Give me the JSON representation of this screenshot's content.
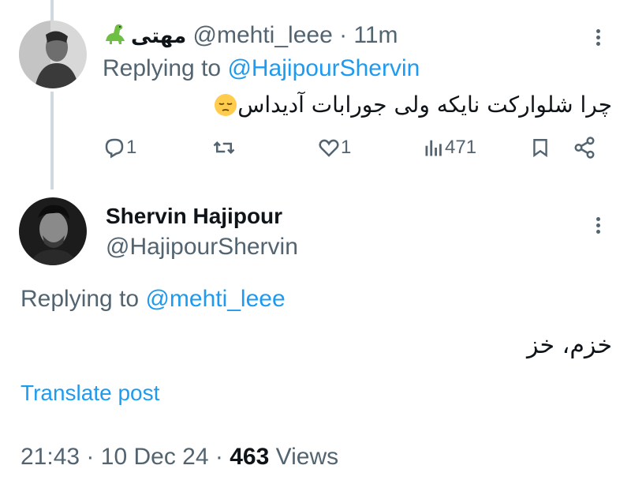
{
  "reply_tweet": {
    "author_name": "مهتی",
    "author_handle": "@mehti_leee",
    "time": "· 11m",
    "replying_prefix": "Replying to",
    "replying_to": "@HajipourShervin",
    "text": "چرا شلوارکت نایکه ولی جورابات آدیداس",
    "emoji": "pensive-face",
    "actions": {
      "replies": "1",
      "retweets": "",
      "likes": "1",
      "views": "471"
    }
  },
  "main_tweet": {
    "author_name": "Shervin Hajipour",
    "author_handle": "@HajipourShervin",
    "replying_prefix": "Replying to",
    "replying_to": "@mehti_leee",
    "text": "خزم، خز",
    "translate_label": "Translate post",
    "time": "21:43",
    "date": "10 Dec 24",
    "views_count": "463",
    "views_label": "Views"
  },
  "colors": {
    "accent": "#1d9bf0",
    "secondary_text": "#536471",
    "primary_text": "#0f1419",
    "thread_line": "#cfd9de"
  }
}
